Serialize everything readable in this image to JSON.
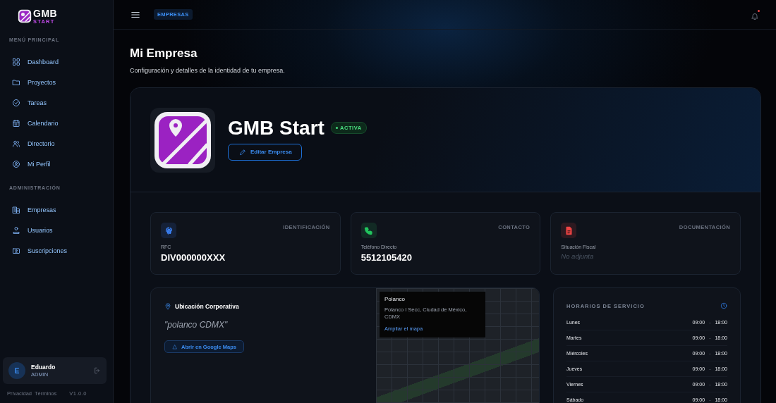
{
  "sidebar": {
    "logo": {
      "title": "GMB",
      "subtitle": "START"
    },
    "sections": [
      {
        "title": "MENÚ PRINCIPAL",
        "items": [
          {
            "label": "Dashboard",
            "selected": false
          },
          {
            "label": "Proyectos",
            "selected": false
          },
          {
            "label": "Tareas",
            "selected": false
          },
          {
            "label": "Calendario",
            "selected": false
          },
          {
            "label": "Directorio",
            "selected": false
          },
          {
            "label": "Mi Perfil",
            "selected": false
          }
        ]
      },
      {
        "title": "ADMINISTRACIÓN",
        "items": [
          {
            "label": "Empresas",
            "selected": false
          },
          {
            "label": "Usuarios",
            "selected": false
          },
          {
            "label": "Suscripciones",
            "selected": false
          }
        ]
      }
    ],
    "user": {
      "initial": "E",
      "name": "Eduardo",
      "role": "ADMIN"
    },
    "footer_links": [
      "Privacidad",
      "Términos"
    ],
    "version": "V1.0.0"
  },
  "topbar": {
    "breadcrumb": "EMPRESAS",
    "notification_unread": true
  },
  "page": {
    "title": "Mi Empresa",
    "subtitle": "Configuración y detalles de la identidad de tu empresa."
  },
  "company": {
    "name": "GMB Start",
    "status": "ACTIVA",
    "active": true,
    "edit_button": "Editar Empresa"
  },
  "info_cards": [
    {
      "kind": "fingerprint",
      "color": "#3b82f6",
      "category": "IDENTIFICACIÓN",
      "label": "RFC",
      "value": "DIV000000XXX",
      "missing": false
    },
    {
      "kind": "phone",
      "color": "#22c55e",
      "category": "CONTACTO",
      "label": "Teléfono Directo",
      "value": "5512105420",
      "missing": false
    },
    {
      "kind": "document",
      "color": "#ef4444",
      "category": "DOCUMENTACIÓN",
      "label": "Situación Fiscal",
      "value": "No adjunta",
      "missing": true
    }
  ],
  "location": {
    "title": "Ubicación Corporativa",
    "query": "\"polanco CDMX\"",
    "button": "Abrir en Google Maps",
    "map_card": {
      "title": "Polanco",
      "address": "Polanco I Secc, Ciudad de México, CDMX",
      "link": "Ampliar el mapa"
    }
  },
  "hours": {
    "title": "HORARIOS DE SERVICIO",
    "rows": [
      {
        "day": "Lunes",
        "open": "09:00",
        "separator": "-",
        "close": "18:00"
      },
      {
        "day": "Martes",
        "open": "09:00",
        "separator": "-",
        "close": "18:00"
      },
      {
        "day": "Miércoles",
        "open": "09:00",
        "separator": "-",
        "close": "18:00"
      },
      {
        "day": "Jueves",
        "open": "09:00",
        "separator": "-",
        "close": "18:00"
      },
      {
        "day": "Viernes",
        "open": "09:00",
        "separator": "-",
        "close": "18:00"
      },
      {
        "day": "Sábado",
        "open": "09:00",
        "separator": "-",
        "close": "18:00"
      }
    ]
  }
}
